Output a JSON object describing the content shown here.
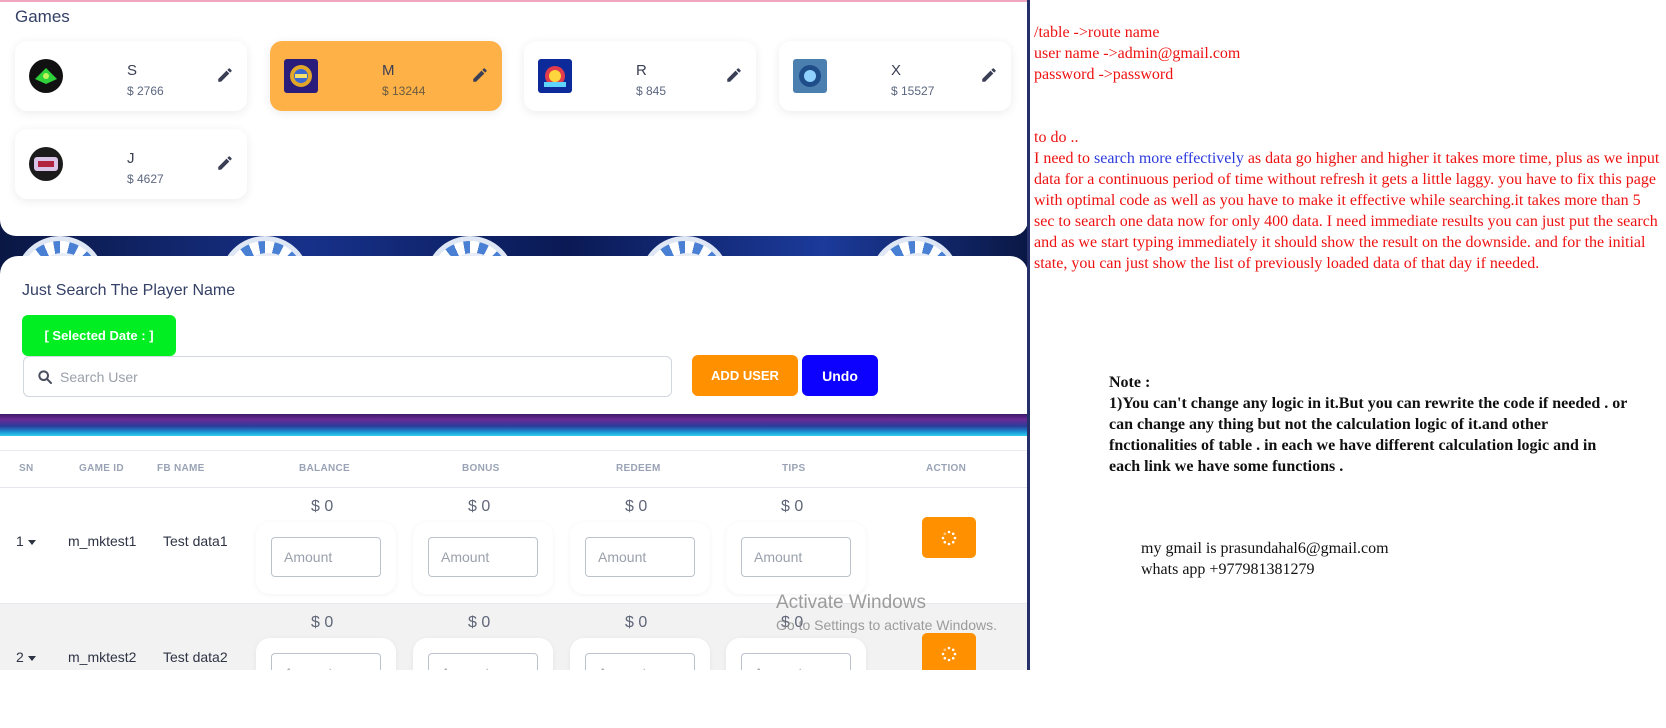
{
  "games": {
    "title": "Games",
    "cards": [
      {
        "name": "S",
        "amount": "$ 2766",
        "active": false
      },
      {
        "name": "M",
        "amount": "$ 13244",
        "active": true
      },
      {
        "name": "R",
        "amount": "$ 845",
        "active": false
      },
      {
        "name": "X",
        "amount": "$ 15527",
        "active": false
      },
      {
        "name": "J",
        "amount": "$ 4627",
        "active": false
      }
    ]
  },
  "search": {
    "title": "Just Search The Player Name",
    "selected_date_label": "[ Selected Date : ]",
    "placeholder": "Search User",
    "add_user_label": "ADD USER",
    "undo_label": "Undo"
  },
  "table": {
    "headers": [
      "SN",
      "GAME ID",
      "FB NAME",
      "BALANCE",
      "BONUS",
      "REDEEM",
      "TIPS",
      "ACTION"
    ],
    "amount_placeholder": "Amount",
    "rows": [
      {
        "sn": "1",
        "game_id": "m_mktest1",
        "fb_name": "Test data1",
        "balance": "$ 0",
        "bonus": "$ 0",
        "redeem": "$ 0",
        "tips": "$ 0"
      },
      {
        "sn": "2",
        "game_id": "m_mktest2",
        "fb_name": "Test data2",
        "balance": "$ 0",
        "bonus": "$ 0",
        "redeem": "$ 0",
        "tips": "$ 0"
      }
    ]
  },
  "watermark": {
    "line1": "Activate Windows",
    "line2": "Go to Settings to activate Windows."
  },
  "notes": {
    "route": "/table ->route name",
    "username": "user name ->admin@gmail.com",
    "password": "password ->password",
    "todo_title": "to do ..",
    "todo_prefix": "I need to",
    "todo_highlight": "search more effectively",
    "todo_rest": "as data go higher and higher it takes more time, plus as we input data for a continuous period of time without refresh it gets a little laggy. you have to fix this page with optimal code as well as you have to make it effective while searching.it takes more than 5 sec to search one data now for only 400 data. I need immediate results you can just put the search and as we start typing immediately it should show the result on the downside. and for the initial state, you can just show the list of previously loaded data of that day if needed.",
    "note_title": "Note :",
    "note_body": "1)You can't change any logic in it.But you can rewrite the code if needed . or can change any thing but not the calculation logic of it.and other fnctionalities of table . in each we have different calculation logic and in each link we have some functions .",
    "gmail": "my gmail is prasundahal6@gmail.com",
    "whatsapp": "whats app +977981381279"
  },
  "colors": {
    "active_card": "#fdb147",
    "selected_date": "#00ee22",
    "add_user": "#ff9100",
    "undo": "#0c00ff",
    "notes_red": "#ee1111",
    "notes_blue": "#2c3bdc"
  }
}
